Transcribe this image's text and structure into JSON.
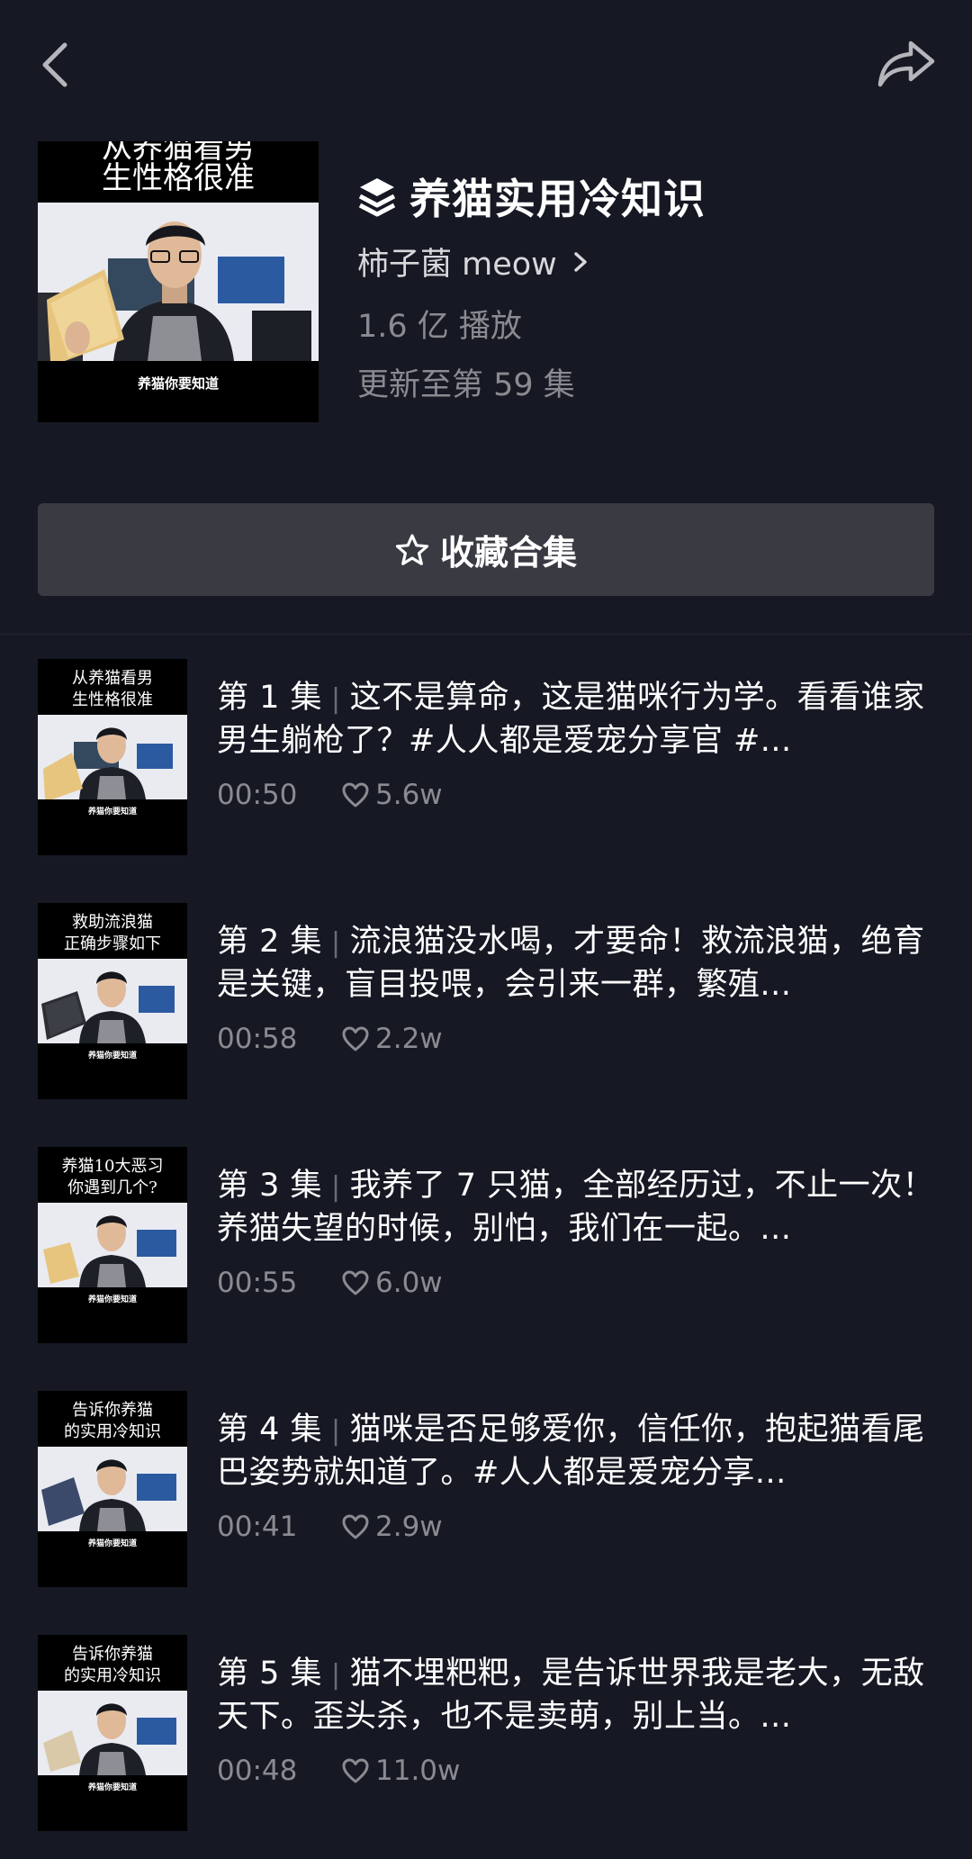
{
  "colors": {
    "background": "#161823",
    "button_bg": "#393a42",
    "text_primary": "#ffffff",
    "text_secondary": "#8a8b91"
  },
  "topbar": {
    "back_icon": "chevron-left-icon",
    "share_icon": "share-arrow-icon"
  },
  "collection": {
    "cover": {
      "title_line1": "从养猫看男",
      "title_line2": "生性格很准",
      "footer": "养猫你要知道"
    },
    "icon": "collection-stack-icon",
    "title": "养猫实用冷知识",
    "author": "柿子菌 meow",
    "plays": "1.6 亿 播放",
    "updated": "更新至第 59 集"
  },
  "favorite_button": {
    "icon": "star-outline-icon",
    "label": "收藏合集"
  },
  "episodes": [
    {
      "thumb_line1": "从养猫看男",
      "thumb_line2": "生性格很准",
      "thumb_footer": "养猫你要知道",
      "label": "第 1 集",
      "desc": "这不是算命，这是猫咪行为学。看看谁家男生躺枪了？#人人都是爱宠分享官 #...",
      "duration": "00:50",
      "likes": "5.6w"
    },
    {
      "thumb_line1": "救助流浪猫",
      "thumb_line2": "正确步骤如下",
      "thumb_footer": "养猫你要知道",
      "label": "第 2 集",
      "desc": "流浪猫没水喝，才要命！救流浪猫，绝育是关键，盲目投喂，会引来一群，繁殖...",
      "duration": "00:58",
      "likes": "2.2w"
    },
    {
      "thumb_line1": "养猫10大恶习",
      "thumb_line2": "你遇到几个?",
      "thumb_footer": "养猫你要知道",
      "label": "第 3 集",
      "desc": "我养了 7 只猫，全部经历过，不止一次！养猫失望的时候，别怕，我们在一起。...",
      "duration": "00:55",
      "likes": "6.0w"
    },
    {
      "thumb_line1": "告诉你养猫",
      "thumb_line2": "的实用冷知识",
      "thumb_footer": "养猫你要知道",
      "label": "第 4 集",
      "desc": "猫咪是否足够爱你，信任你，抱起猫看尾巴姿势就知道了。#人人都是爱宠分享...",
      "duration": "00:41",
      "likes": "2.9w"
    },
    {
      "thumb_line1": "告诉你养猫",
      "thumb_line2": "的实用冷知识",
      "thumb_footer": "养猫你要知道",
      "label": "第 5 集",
      "desc": "猫不埋粑粑，是告诉世界我是老大，无敌天下。歪头杀，也不是卖萌，别上当。...",
      "duration": "00:48",
      "likes": "11.0w"
    }
  ]
}
